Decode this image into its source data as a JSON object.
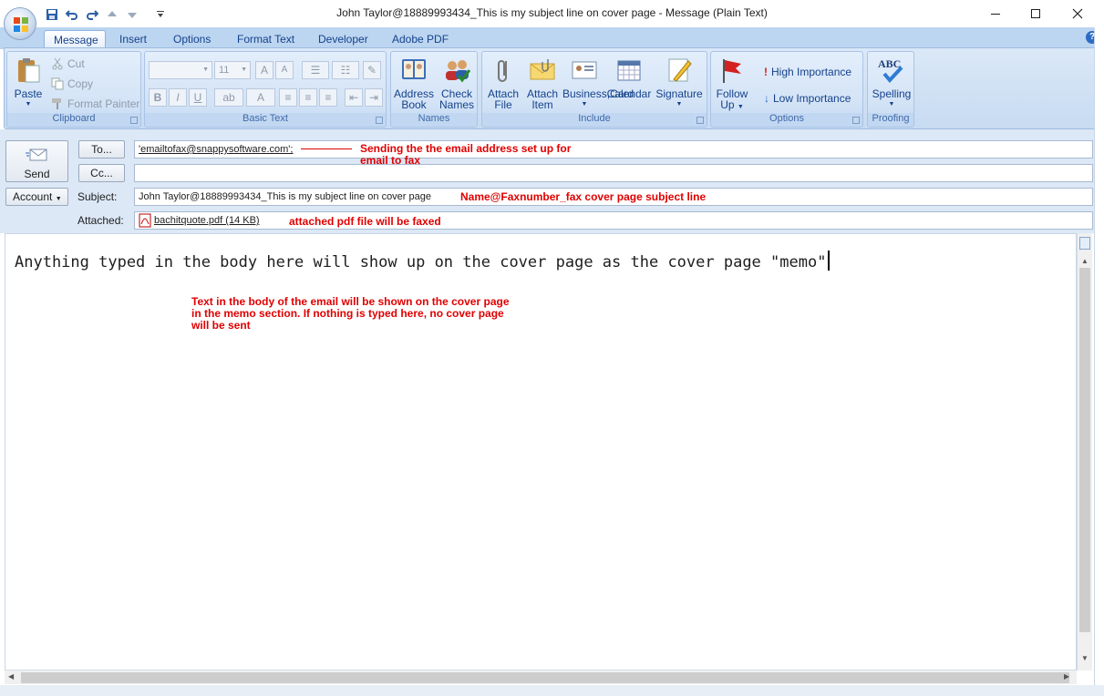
{
  "window": {
    "title": "John Taylor@18889993434_This is my subject line on cover page - Message (Plain Text)"
  },
  "tabs": [
    "Message",
    "Insert",
    "Options",
    "Format Text",
    "Developer",
    "Adobe PDF"
  ],
  "ribbon": {
    "clipboard": {
      "label": "Clipboard",
      "paste": "Paste",
      "cut": "Cut",
      "copy": "Copy",
      "format_painter": "Format Painter"
    },
    "basic_text": {
      "label": "Basic Text",
      "font_size": "11"
    },
    "names": {
      "label": "Names",
      "address_book": [
        "Address",
        "Book"
      ],
      "check_names": [
        "Check",
        "Names"
      ]
    },
    "include": {
      "label": "Include",
      "attach_file": [
        "Attach",
        "File"
      ],
      "attach_item": [
        "Attach",
        "Item"
      ],
      "business_card": [
        "Business",
        "Card"
      ],
      "calendar": "Calendar",
      "signature": "Signature"
    },
    "options": {
      "label": "Options",
      "follow_up": [
        "Follow",
        "Up"
      ],
      "high_importance": "High Importance",
      "low_importance": "Low Importance"
    },
    "proofing": {
      "label": "Proofing",
      "spelling": "Spelling",
      "abc": "ABC"
    }
  },
  "header": {
    "send": "Send",
    "to_button": "To...",
    "cc_button": "Cc...",
    "account_button": "Account",
    "subject_label": "Subject:",
    "attached_label": "Attached:",
    "to_value": "'emailtofax@snappysoftware.com';",
    "cc_value": "",
    "subject_value": "John Taylor@18889993434_This is my subject line on cover page",
    "attachment": "bachitquote.pdf (14 KB)"
  },
  "annotations": {
    "to_note_1": "Sending the the email address set up for",
    "to_note_2": "email to fax",
    "subject_note": "Name@Faxnumber_fax cover page subject line",
    "attached_note": "attached pdf file will be faxed",
    "body_note_1": "Text in the body of the email will be shown on the cover page",
    "body_note_2": "in the memo section.  If nothing is typed here, no cover page",
    "body_note_3": "will be sent"
  },
  "body": {
    "text": "Anything typed in the body here will show up on the cover page as the cover page \"memo\""
  },
  "colors": {
    "ribbon": "#c7dbf2",
    "accent": "#15428b",
    "annotation": "#e00000"
  }
}
